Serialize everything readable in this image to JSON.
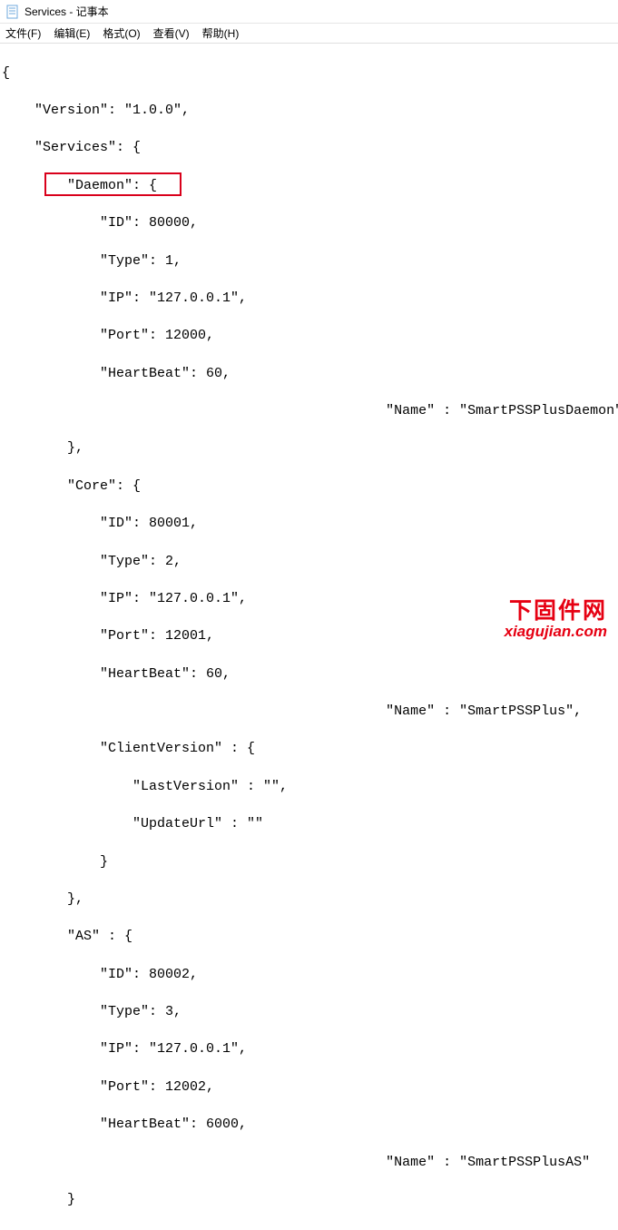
{
  "window": {
    "title": "Services - 记事本"
  },
  "menu": {
    "file": "文件(F)",
    "edit": "编辑(E)",
    "format": "格式(O)",
    "view": "查看(V)",
    "help": "帮助(H)"
  },
  "editor": {
    "l1": "{",
    "l2": "    \"Version\": \"1.0.0\",",
    "l3": "    \"Services\": {",
    "l4": "        \"Daemon\": {",
    "l5": "            \"ID\": 80000,",
    "l6": "            \"Type\": 1,",
    "l7": "            \"IP\": \"127.0.0.1\",",
    "l8": "            \"Port\": 12000,",
    "l9": "            \"HeartBeat\": 60,",
    "l10": "                                               \"Name\" : \"SmartPSSPlusDaemon\"",
    "l11": "        },",
    "l12": "        \"Core\": {",
    "l13": "            \"ID\": 80001,",
    "l14": "            \"Type\": 2,",
    "l15": "            \"IP\": \"127.0.0.1\",",
    "l16": "            \"Port\": 12001,",
    "l17": "            \"HeartBeat\": 60,",
    "l18": "                                               \"Name\" : \"SmartPSSPlus\",",
    "l19": "            \"ClientVersion\" : {",
    "l20": "                \"LastVersion\" : \"\",",
    "l21": "                \"UpdateUrl\" : \"\"",
    "l22": "            }",
    "l23": "        },",
    "l24": "        \"AS\" : {",
    "l25": "            \"ID\": 80002,",
    "l26": "            \"Type\": 3,",
    "l27": "            \"IP\": \"127.0.0.1\",",
    "l28": "            \"Port\": 12002,",
    "l29": "            \"HeartBeat\": 6000,",
    "l30": "                                               \"Name\" : \"SmartPSSPlusAS\"",
    "l31": "        }"
  },
  "watermark": {
    "cn": "下固件网",
    "en": "xiagujian.com"
  }
}
